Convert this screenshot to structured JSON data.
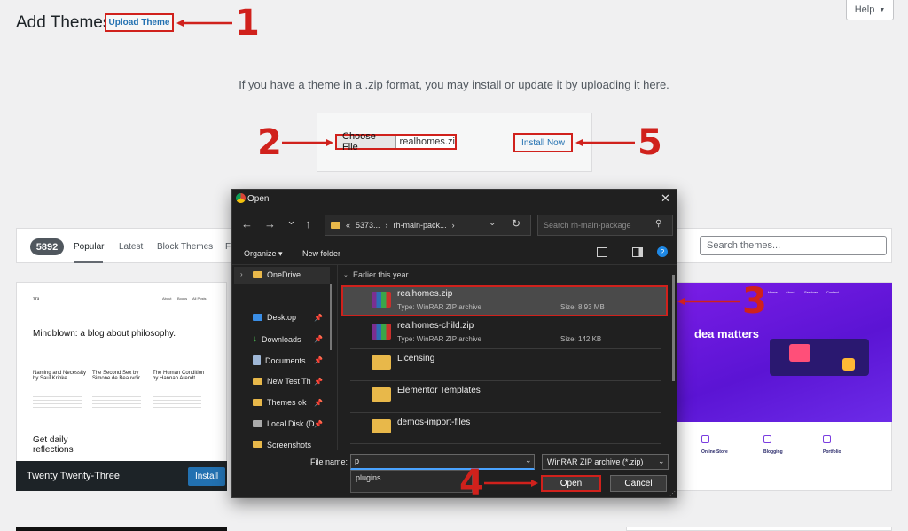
{
  "header": {
    "title": "Add Themes",
    "upload_theme": "Upload Theme",
    "help": "Help",
    "help_caret": "▼"
  },
  "upload": {
    "intro": "If you have a theme in a .zip format, you may install or update it by uploading it here.",
    "choose_file": "Choose File",
    "file_chosen": "realhomes.zip",
    "install_now": "Install Now"
  },
  "filter": {
    "count": "5892",
    "tabs": [
      "Popular",
      "Latest",
      "Block Themes",
      "Fa"
    ],
    "search_placeholder": "Search themes..."
  },
  "cards": {
    "card1": {
      "name": "Twenty Twenty-Three",
      "install": "Install",
      "preview_logo": "TT3",
      "preview_nav": [
        "About",
        "Books",
        "All Posts"
      ],
      "preview_headline": "Mindblown: a blog about philosophy.",
      "preview_posts": [
        {
          "title": "Naming and Necessity by Saul Kripke"
        },
        {
          "title": "The Second Sex by Simone de Beauvoir"
        },
        {
          "title": "The Human Condition by Hannah Arendt"
        }
      ],
      "preview_footer": "Get daily reflections"
    },
    "card3": {
      "nav": [
        "Home",
        "About",
        "Services",
        "Contact"
      ],
      "headline": "dea matters",
      "features": [
        "Online Store",
        "Blogging",
        "Portfolio"
      ]
    }
  },
  "dialog": {
    "title": "Open",
    "close": "✕",
    "nav_back": "←",
    "nav_forward": "→",
    "nav_down": "⌄",
    "nav_up": "↑",
    "address": [
      "«",
      "5373...",
      "›",
      "rh-main-pack...",
      "›"
    ],
    "search_placeholder": "Search rh-main-package",
    "organize": "Organize ▾",
    "new_folder": "New folder",
    "help_glyph": "?",
    "nav_pane": [
      {
        "label": "OneDrive",
        "icon": "folder-icon"
      },
      {
        "label": "Desktop",
        "icon": "desktop-icon",
        "pinned": true
      },
      {
        "label": "Downloads",
        "icon": "download-icon",
        "pinned": true
      },
      {
        "label": "Documents",
        "icon": "documents-icon",
        "pinned": true
      },
      {
        "label": "New Test  Th",
        "icon": "folder-icon",
        "pinned": true
      },
      {
        "label": "Themes ok",
        "icon": "folder-icon",
        "pinned": true
      },
      {
        "label": "Local Disk (D",
        "icon": "drive-icon",
        "pinned": true
      },
      {
        "label": "Screenshots",
        "icon": "folder-icon"
      }
    ],
    "group_label": "Earlier this year",
    "files": [
      {
        "name": "realhomes.zip",
        "type": "Type: WinRAR ZIP archive",
        "size": "Size: 8,93 MB"
      },
      {
        "name": "realhomes-child.zip",
        "type": "Type: WinRAR ZIP archive",
        "size": "Size: 142 KB"
      },
      {
        "name": "Licensing"
      },
      {
        "name": "Elementor Templates"
      },
      {
        "name": "demos-import-files"
      }
    ],
    "file_name_label": "File name:",
    "file_name_value": "p",
    "suggestion": "plugins",
    "file_type": "WinRAR ZIP archive (*.zip)",
    "open": "Open",
    "cancel": "Cancel"
  },
  "annotations": [
    "1",
    "2",
    "3",
    "4",
    "5"
  ],
  "colors": {
    "annotation_red": "#d0211c",
    "wp_blue": "#2271b1",
    "dialog_bg": "#202020"
  }
}
